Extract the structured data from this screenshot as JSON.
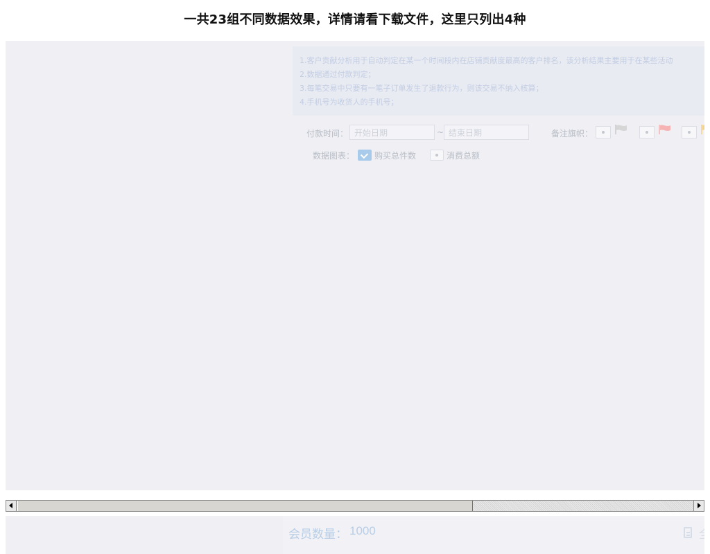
{
  "page": {
    "title": "一共23组不同数据效果，详情请看下载文件，这里只列出4种"
  },
  "notes": [
    "1.客户贡献分析用于自动判定在某一个时间段内在店铺贡献度最高的客户排名，该分析结果主要用于在某些活动",
    "2.数据通过付款判定；",
    "3.每笔交易中只要有一笔子订单发生了退款行为，则该交易不纳入核算；",
    "4.手机号为收货人的手机号；"
  ],
  "filters": {
    "payment_time_label": "付款时间：",
    "start_placeholder": "开始日期",
    "separator": "~",
    "end_placeholder": "结束日期",
    "flag_label": "备注旗帜：",
    "flags": [
      {
        "icon": "grey-flag-icon",
        "color": "#cccccc"
      },
      {
        "icon": "red-flag-icon",
        "color": "#f7b5b5"
      },
      {
        "icon": "yellow-flag-icon",
        "color": "#f8d58a"
      }
    ],
    "chart_label": "数据图表：",
    "chart_options": [
      {
        "label": "购买总件数",
        "checked": true
      },
      {
        "label": "消费总额",
        "checked": false
      }
    ]
  },
  "summary": {
    "member_label": "会员数量：",
    "member_count": "1000",
    "export_icon": "document-icon",
    "cut_text": "全"
  }
}
